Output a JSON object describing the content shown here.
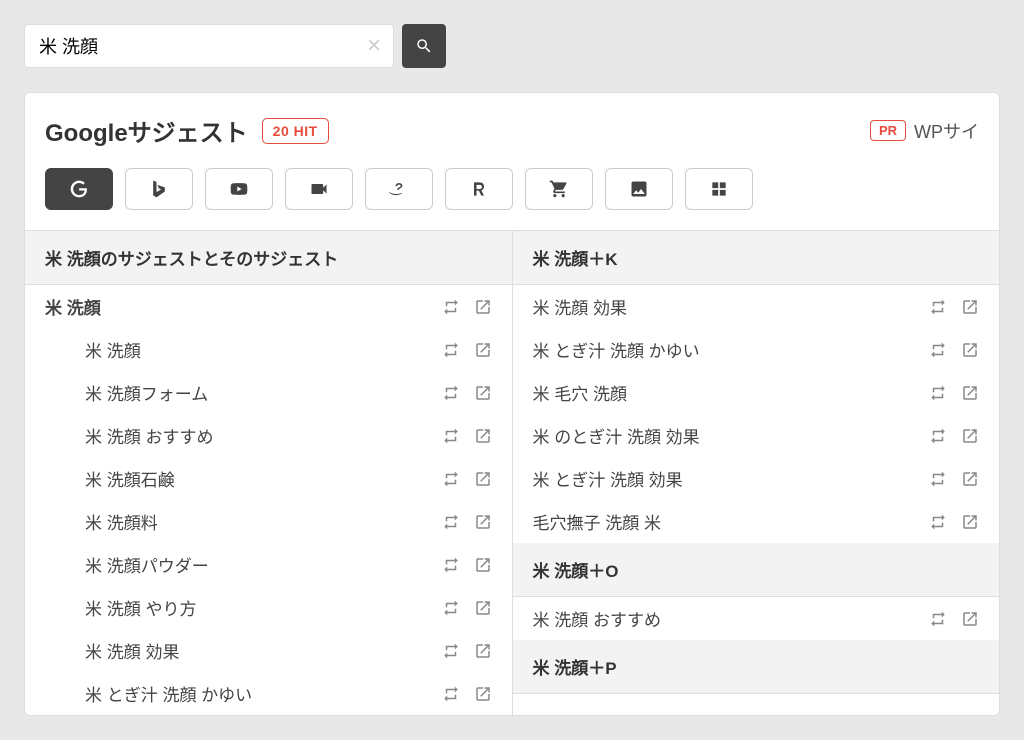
{
  "search": {
    "value": "米 洗顔",
    "placeholder": ""
  },
  "title": "Googleサジェスト",
  "hit": "20 HIT",
  "pr": {
    "badge": "PR",
    "text": "WPサイ"
  },
  "tabs": [
    "google",
    "bing",
    "youtube",
    "video",
    "amazon",
    "rakuten",
    "shopping",
    "image",
    "grid"
  ],
  "left": {
    "header": "米 洗顔のサジェストとそのサジェスト",
    "root": "米 洗顔",
    "items": [
      "米 洗顔",
      "米 洗顔フォーム",
      "米 洗顔 おすすめ",
      "米 洗顔石鹸",
      "米 洗顔料",
      "米 洗顔パウダー",
      "米 洗顔 やり方",
      "米 洗顔 効果",
      "米 とぎ汁 洗顔 かゆい"
    ]
  },
  "right": {
    "groups": [
      {
        "header": "米 洗顔＋K",
        "items": [
          "米 洗顔 効果",
          "米 とぎ汁 洗顔 かゆい",
          "米 毛穴 洗顔",
          "米 のとぎ汁 洗顔 効果",
          "米 とぎ汁 洗顔 効果",
          "毛穴撫子 洗顔 米"
        ]
      },
      {
        "header": "米 洗顔＋O",
        "items": [
          "米 洗顔 おすすめ"
        ]
      },
      {
        "header": "米 洗顔＋P",
        "items": []
      }
    ]
  }
}
